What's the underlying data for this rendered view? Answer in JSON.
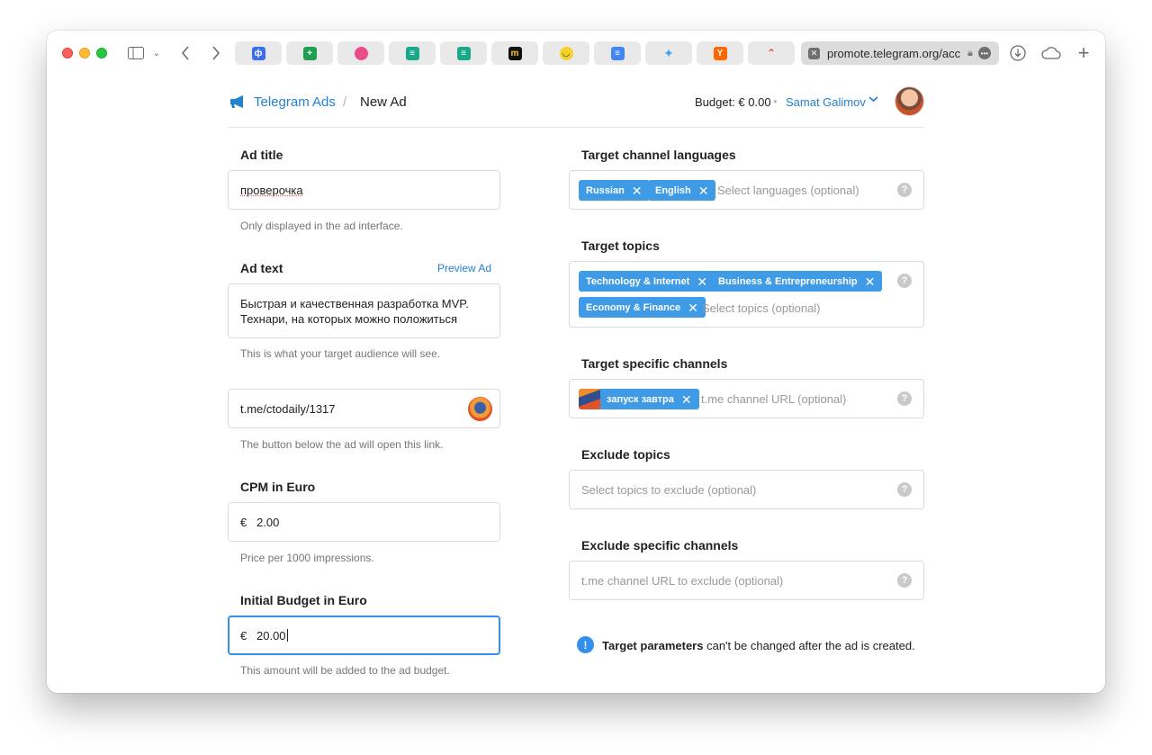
{
  "browser": {
    "url": "promote.telegram.org/acc",
    "tab_icons": [
      "disqus-like-icon",
      "sheets-icon",
      "dribbble-icon",
      "docs-green-icon",
      "docs-green-2-icon",
      "miro-icon",
      "emoji-icon",
      "gdocs-icon",
      "sparkle-icon",
      "ycombinator-icon",
      "mountain-icon"
    ]
  },
  "header": {
    "brand": "Telegram Ads",
    "separator": "/",
    "current": "New Ad",
    "budget": "Budget: € 0.00",
    "user": "Samat Galimov"
  },
  "left": {
    "ad_title": {
      "label": "Ad title",
      "value": "проверочка",
      "help": "Only displayed in the ad interface."
    },
    "ad_text": {
      "label": "Ad text",
      "preview": "Preview Ad",
      "line1": "Быстрая и качественная разработка MVP.",
      "line2": "Технари, на которых можно положиться",
      "help": "This is what your target audience will see."
    },
    "link": {
      "value": "t.me/ctodaily/1317",
      "help": "The button below the ad will open this link."
    },
    "cpm": {
      "label": "CPM in Euro",
      "currency": "€",
      "value": "2.00",
      "help": "Price per 1000 impressions."
    },
    "budget": {
      "label": "Initial Budget in Euro",
      "currency": "€",
      "value": "20.00",
      "help": "This amount will be added to the ad budget."
    }
  },
  "right": {
    "languages": {
      "label": "Target channel languages",
      "chips": [
        "Russian",
        "English"
      ],
      "placeholder": "Select languages (optional)"
    },
    "topics": {
      "label": "Target topics",
      "chips": [
        "Technology & Internet",
        "Business & Entrepreneurship",
        "Economy & Finance"
      ],
      "placeholder": "Select topics (optional)"
    },
    "channels": {
      "label": "Target specific channels",
      "chip": "запуск завтра",
      "placeholder": "t.me channel URL (optional)"
    },
    "exclude_topics": {
      "label": "Exclude topics",
      "placeholder": "Select topics to exclude (optional)"
    },
    "exclude_channels": {
      "label": "Exclude specific channels",
      "placeholder": "t.me channel URL to exclude (optional)"
    },
    "notice": {
      "bold": "Target parameters",
      "rest": " can't be changed after the ad is created."
    }
  },
  "colors": {
    "accent": "#2481cc",
    "chip": "#3f9be6",
    "focus": "#3390ec"
  }
}
